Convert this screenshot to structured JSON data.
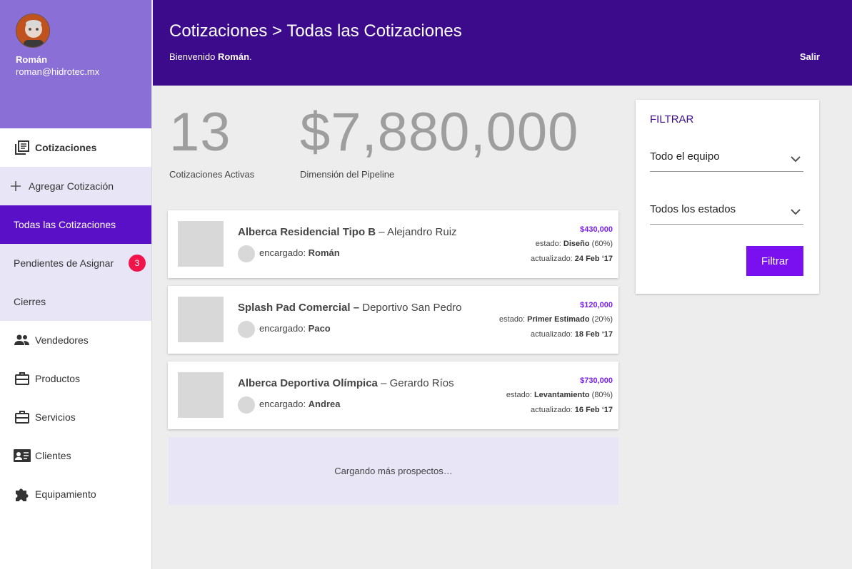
{
  "user": {
    "name": "Román",
    "email": "roman@hidrotec.mx"
  },
  "header": {
    "title": "Cotizaciones > Todas las Cotizaciones",
    "welcome_prefix": "Bienvenido ",
    "welcome_name": "Román",
    "welcome_suffix": ".",
    "logout": "Salir"
  },
  "sidebar": {
    "section": "Cotizaciones",
    "sub_items": [
      {
        "label": "Agregar Cotización"
      },
      {
        "label": "Todas las Cotizaciones"
      },
      {
        "label": "Pendientes de Asignar",
        "badge": "3"
      },
      {
        "label": "Cierres"
      }
    ],
    "items": [
      {
        "label": "Vendedores",
        "icon": "people-icon"
      },
      {
        "label": "Productos",
        "icon": "briefcase-icon"
      },
      {
        "label": "Servicios",
        "icon": "briefcase-icon"
      },
      {
        "label": "Clientes",
        "icon": "contact-card-icon"
      },
      {
        "label": "Equipamiento",
        "icon": "puzzle-icon"
      }
    ]
  },
  "stats": {
    "active_count": "13",
    "active_label": "Cotizaciones Activas",
    "pipeline_value": "$7,880,000",
    "pipeline_label": "Dimensión del Pipeline"
  },
  "quotes": [
    {
      "title": "Alberca Residencial Tipo B",
      "sep": " – ",
      "client": "Alejandro Ruiz",
      "owner_label": "encargado: ",
      "owner": "Román",
      "price": "$430,000",
      "state_label": "estado: ",
      "state": "Diseño",
      "state_pct": " (60%)",
      "updated_label": "actualizado: ",
      "updated": "24 Feb ‘17"
    },
    {
      "title": "Splash Pad Comercial –",
      "sep": " ",
      "client": "Deportivo San Pedro",
      "owner_label": "encargado: ",
      "owner": "Paco",
      "price": "$120,000",
      "state_label": "estado: ",
      "state": "Primer Estimado",
      "state_pct": " (20%)",
      "updated_label": "actualizado: ",
      "updated": "18 Feb ‘17"
    },
    {
      "title": "Alberca Deportiva Olímpica",
      "sep": " – ",
      "client": "Gerardo Ríos",
      "owner_label": "encargado: ",
      "owner": "Andrea",
      "price": "$730,000",
      "state_label": "estado: ",
      "state": "Levantamiento",
      "state_pct": " (80%)",
      "updated_label": "actualizado: ",
      "updated": "16 Feb ‘17"
    }
  ],
  "loading_text": "Cargando más prospectos…",
  "filter": {
    "title": "FILTRAR",
    "team": "Todo el equipo",
    "states": "Todos los estados",
    "button": "Filtrar"
  },
  "colors": {
    "header": "#3c0b8c",
    "profile": "#8a6fd6",
    "active": "#5a10c6",
    "accent": "#7a10f0",
    "badge": "#f0144b"
  }
}
